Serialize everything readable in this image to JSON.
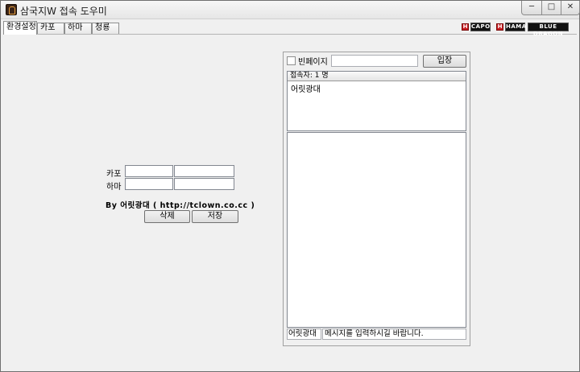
{
  "window": {
    "title": "삼국지W 접속 도우미",
    "minimize_glyph": "─",
    "maximize_glyph": "□",
    "close_glyph": "✕"
  },
  "tabs": [
    {
      "label": "환경설정",
      "active": true
    },
    {
      "label": "카포",
      "active": false
    },
    {
      "label": "하마",
      "active": false
    },
    {
      "label": "청룡",
      "active": false
    }
  ],
  "logos": {
    "capo_badge": "H",
    "capo": "CAPO",
    "hama_badge": "H",
    "hama": "HAMA",
    "blue_dragon": "BLUE DRAGON"
  },
  "settings": {
    "rows": [
      {
        "label": "카포",
        "field1": "",
        "field2": ""
      },
      {
        "label": "하마",
        "field1": "",
        "field2": ""
      }
    ],
    "credit": "By 어릿광대 ( http://tclown.co.cc )",
    "delete_label": "삭제",
    "save_label": "저장"
  },
  "chat": {
    "empty_room_label": "빈페이지",
    "empty_room_checked": false,
    "room_input_value": "",
    "enter_label": "입장",
    "user_header": "접속자: 1 명",
    "users": [
      "어릿광대"
    ],
    "nickname": "어릿광대",
    "message_placeholder": "메시지를 입력하시길 바랍니다."
  },
  "colors": {
    "window_bg": "#f0f0f0",
    "logo_red": "#c8191e",
    "logo_black": "#111111"
  }
}
